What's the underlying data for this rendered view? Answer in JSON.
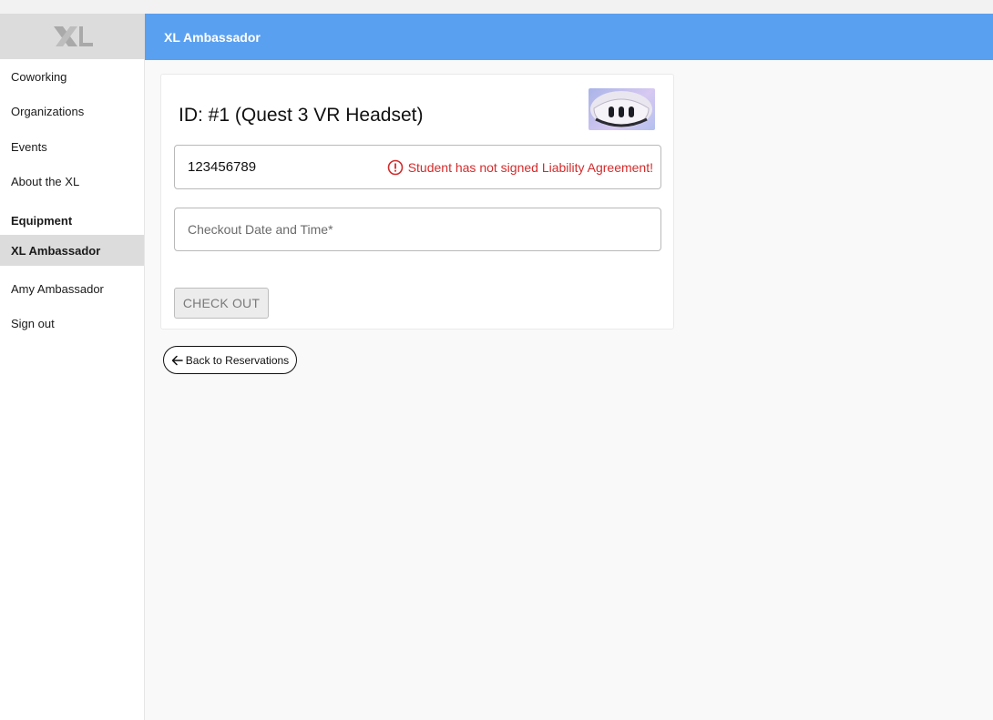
{
  "app": {
    "header_title": "XL Ambassador",
    "accent_color": "#5aa0f0"
  },
  "sidebar": {
    "logo": "XL",
    "items": [
      {
        "label": "Coworking"
      },
      {
        "label": "Organizations"
      },
      {
        "label": "Events"
      },
      {
        "label": "About the XL"
      }
    ],
    "section_label": "Equipment",
    "active_item": {
      "label": "XL Ambassador"
    },
    "user_name": "Amy Ambassador",
    "sign_out": "Sign out"
  },
  "card": {
    "title": "ID: #1 (Quest 3 VR Headset)",
    "thumbnail_icon": "vr-headset-icon",
    "student_id_value": "123456789",
    "error_message": "Student has not signed Liability Agreement!",
    "error_color": "#d42b2b",
    "checkout_placeholder": "Checkout Date and Time*",
    "checkout_button": "CHECK OUT"
  },
  "back_button": "Back to Reservations"
}
